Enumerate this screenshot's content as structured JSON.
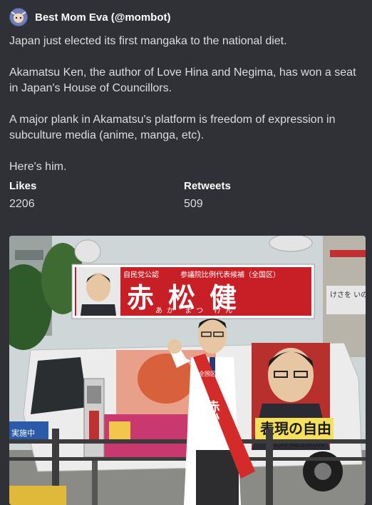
{
  "embed": {
    "author": {
      "name": "Best Mom Eva (@mombot)"
    },
    "description": [
      "Japan just elected its first mangaka to the national diet.",
      "Akamatsu Ken, the author of Love Hina and Negima, has won a seat in Japan's House of Councillors.",
      "A major plank in Akamatsu's platform is freedom of expression in subculture media (anime, manga, etc).",
      "Here's him."
    ],
    "fields": [
      {
        "name": "Likes",
        "value": "2206"
      },
      {
        "name": "Retweets",
        "value": "509"
      }
    ],
    "image": {
      "sign_small_left": "自民党公認",
      "sign_small_mid": "参議院比例代表候補（全国区）",
      "sign_name": "赤松健",
      "sign_reading": "あか まつ けん",
      "sash_text": "赤松健",
      "sash_top": "全国区",
      "van_slogan": "表現の自由",
      "van_sub": "EXPRESSION",
      "bg_sign_right": "けさを いのまま",
      "bg_banner_left": "実施中"
    },
    "colors": {
      "background": "#2f3136",
      "text": "#dcddde",
      "heading": "#ffffff",
      "sign_red": "#c81f26",
      "sash_red": "#d42a2a"
    }
  }
}
